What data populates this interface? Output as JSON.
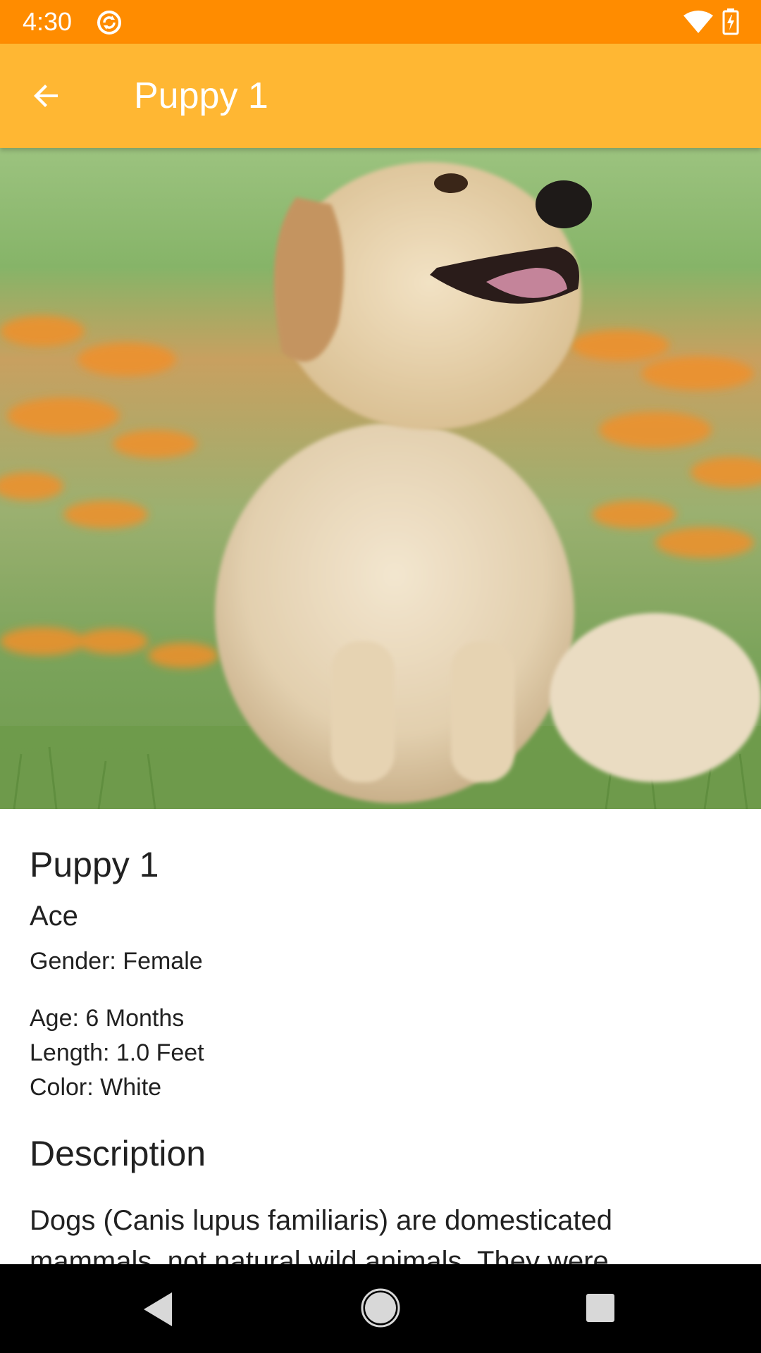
{
  "status_bar": {
    "time": "4:30",
    "background_color": "#ff8c00",
    "icons": [
      "sync-icon",
      "wifi-icon",
      "battery-charging-icon"
    ]
  },
  "app_bar": {
    "title": "Puppy 1",
    "background_color": "#ffb733",
    "back_icon": "arrow-back-icon"
  },
  "hero_image": {
    "subject": "puppy-photo"
  },
  "details": {
    "title": "Puppy 1",
    "name": "Ace",
    "gender": "Gender: Female",
    "age": "Age: 6 Months",
    "length": "Length: 1.0 Feet",
    "color": "Color: White"
  },
  "description": {
    "heading": "Description",
    "text": "Dogs (Canis lupus familiaris) are domesticated mammals, not natural wild animals. They were"
  },
  "nav_bar": {
    "icons": [
      "nav-back-icon",
      "nav-home-icon",
      "nav-recents-icon"
    ]
  }
}
